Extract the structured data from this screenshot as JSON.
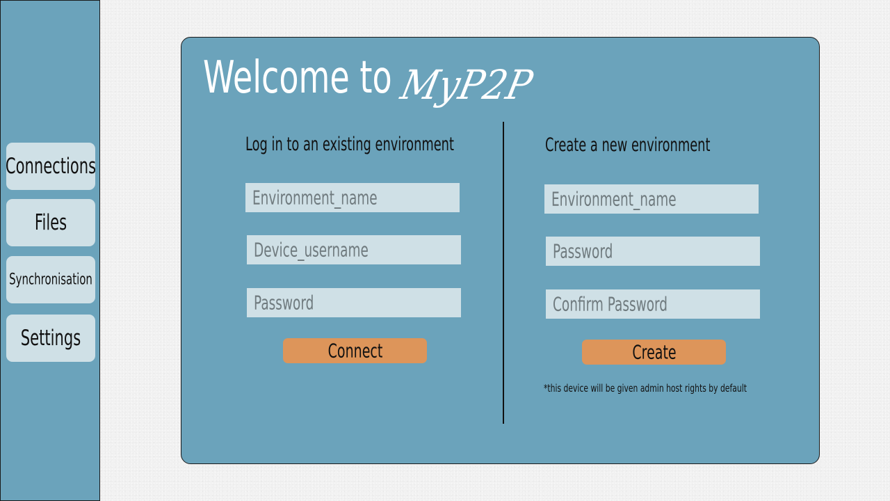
{
  "sidebar": {
    "items": [
      {
        "label": "Connections"
      },
      {
        "label": "Files"
      },
      {
        "label": "Synchronisation"
      },
      {
        "label": "Settings"
      }
    ]
  },
  "header": {
    "welcome_text": "Welcome to",
    "brand": "MyP2P"
  },
  "login": {
    "title": "Log in to an existing environment",
    "environment_placeholder": "Environment_name",
    "username_placeholder": "Device_username",
    "password_placeholder": "Password",
    "button_label": "Connect"
  },
  "create": {
    "title": "Create a new environment",
    "environment_placeholder": "Environment_name",
    "password_placeholder": "Password",
    "confirm_placeholder": "Confirm Password",
    "button_label": "Create",
    "note": "*this device will be given admin host rights by default"
  },
  "colors": {
    "panel": "#6ba3bb",
    "field": "#cfe0e6",
    "button": "#dd955a",
    "background": "#f1f1f1"
  }
}
